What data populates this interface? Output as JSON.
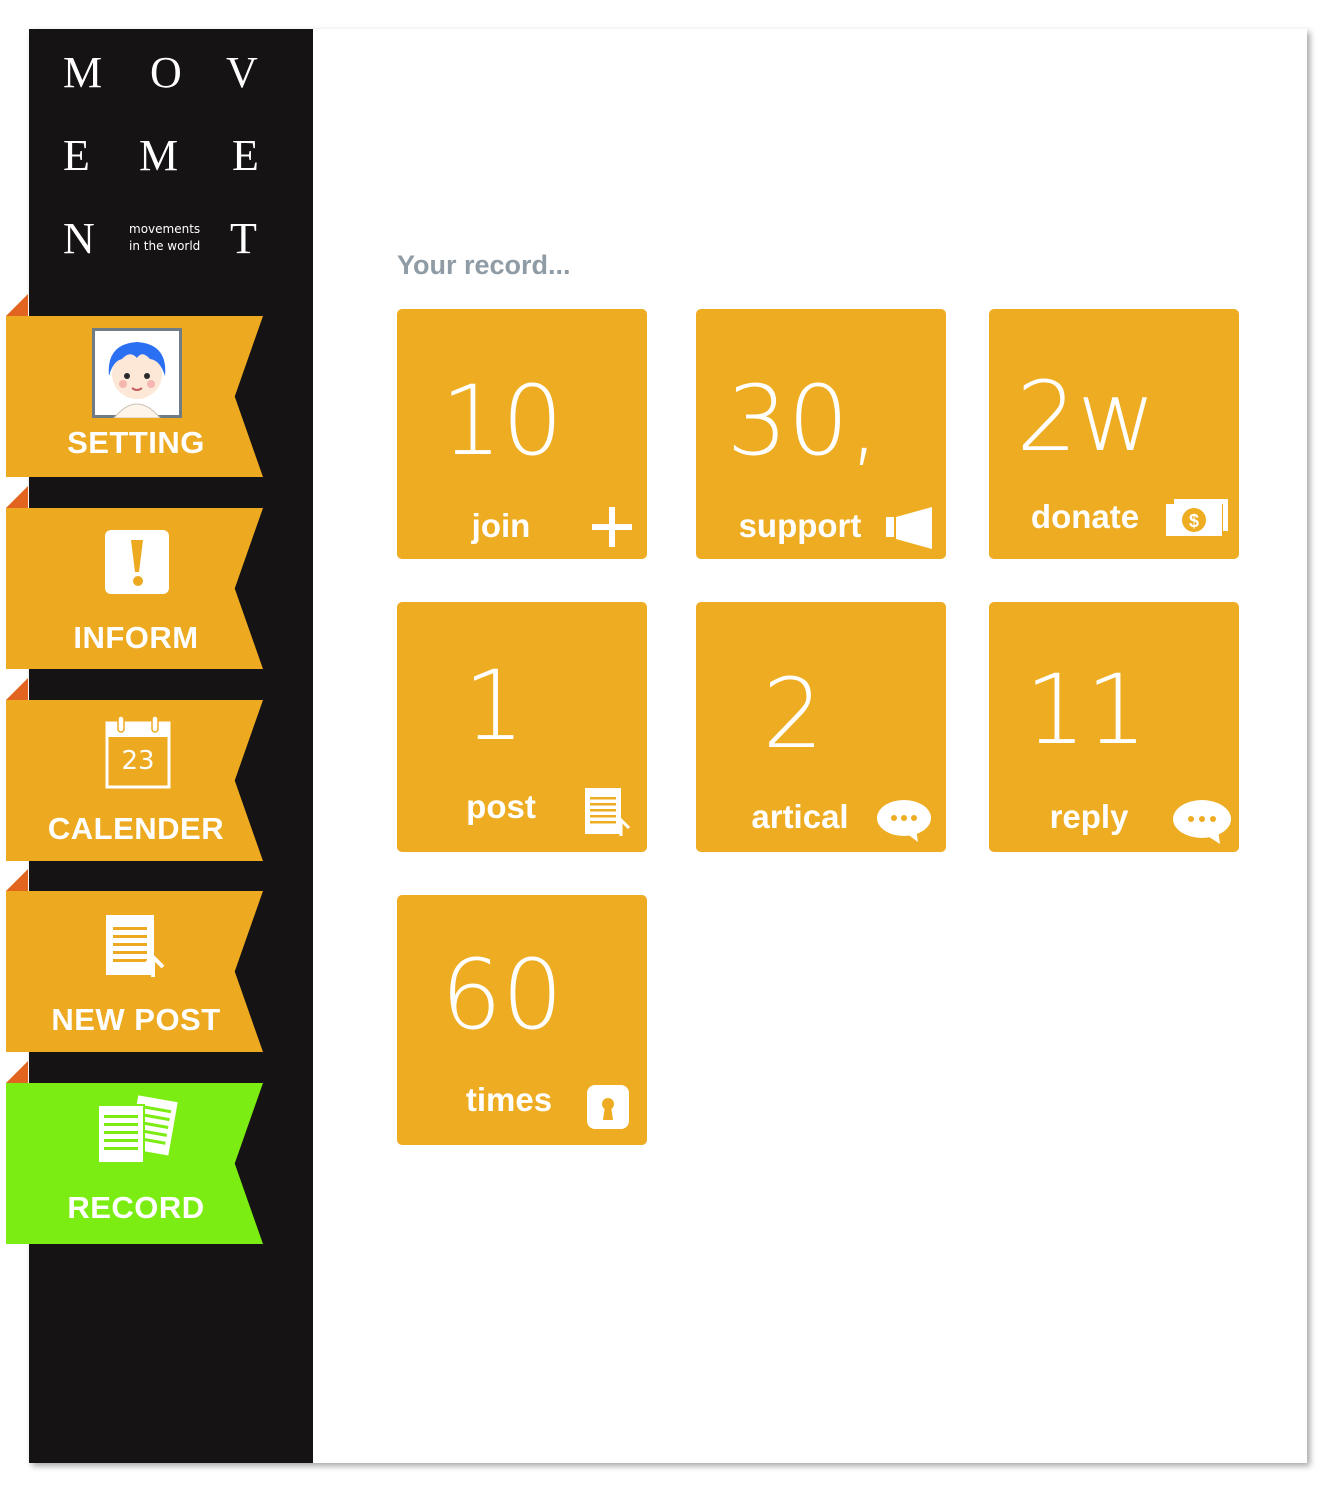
{
  "logo": {
    "letters": [
      "M",
      "O",
      "V",
      "E",
      "M",
      "E",
      "N",
      "T"
    ],
    "tagline_line1": "movements",
    "tagline_line2": "in the world"
  },
  "sidebar": {
    "items": [
      {
        "label": "SETTING",
        "icon": "avatar-icon",
        "active": false
      },
      {
        "label": "INFORM",
        "icon": "exclamation-icon",
        "active": false
      },
      {
        "label": "CALENDER",
        "icon": "calendar-icon",
        "active": false,
        "icon_text": "23"
      },
      {
        "label": "NEW POST",
        "icon": "document-upload-icon",
        "active": false
      },
      {
        "label": "RECORD",
        "icon": "papers-icon",
        "active": true
      }
    ]
  },
  "main": {
    "title": "Your record...",
    "cards": [
      {
        "value": "10",
        "label": "join",
        "icon": "plus-icon"
      },
      {
        "value": "30,",
        "label": "support",
        "icon": "megaphone-icon"
      },
      {
        "value": "2w",
        "label": "donate",
        "icon": "money-icon"
      },
      {
        "value": "1",
        "label": "post",
        "icon": "document-upload-icon"
      },
      {
        "value": "2",
        "label": "artical",
        "icon": "chat-bubble-icon"
      },
      {
        "value": "11",
        "label": "reply",
        "icon": "chat-bubble-icon"
      },
      {
        "value": "60",
        "label": "times",
        "icon": "lock-icon"
      }
    ]
  },
  "colors": {
    "sidebar_bg": "#161314",
    "tab_orange": "#eda920",
    "tab_active": "#7ced12",
    "fold": "#e2651f",
    "card_bg": "#eeac22",
    "title_gray": "#8f9ca5"
  }
}
